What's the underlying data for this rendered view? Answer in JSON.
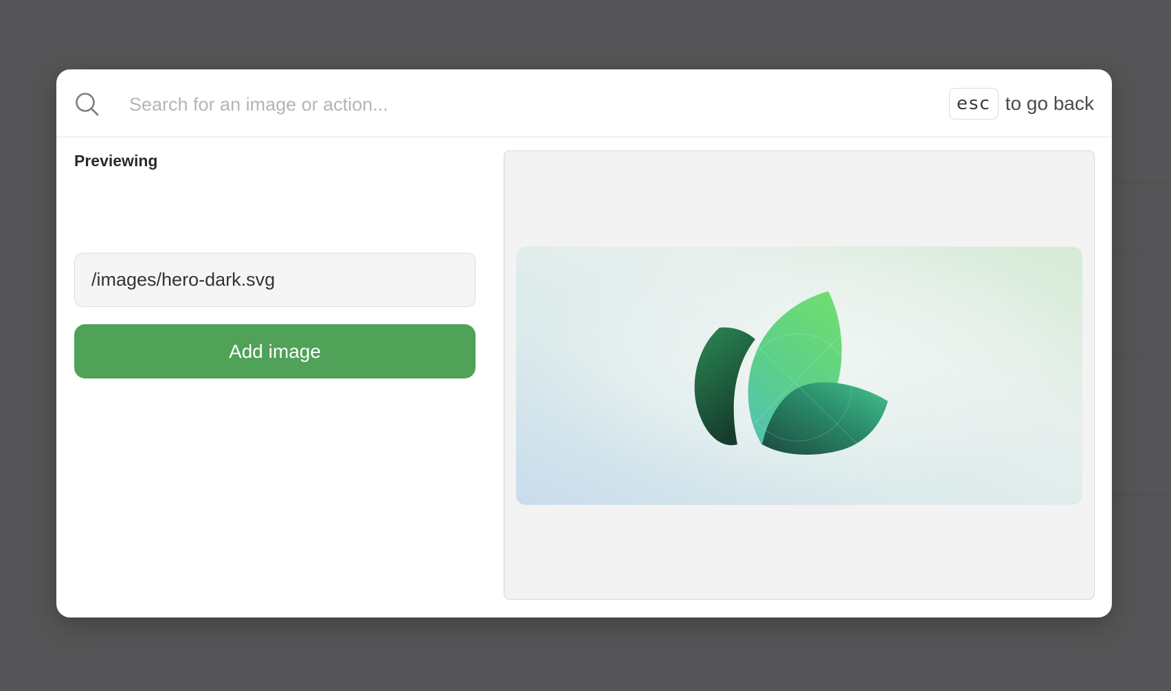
{
  "search": {
    "placeholder": "Search for an image or action..."
  },
  "esc_hint": {
    "key": "esc",
    "text": "to go back"
  },
  "preview": {
    "label": "Previewing",
    "path": "/images/hero-dark.svg",
    "add_button_label": "Add image",
    "image_icon": "leaf-logo-icon"
  },
  "colors": {
    "backdrop": "#555557",
    "modal_bg": "#ffffff",
    "accent_green": "#4fa257",
    "preview_bg": "#f3f3f3"
  },
  "icons": {
    "search": "search-icon"
  }
}
